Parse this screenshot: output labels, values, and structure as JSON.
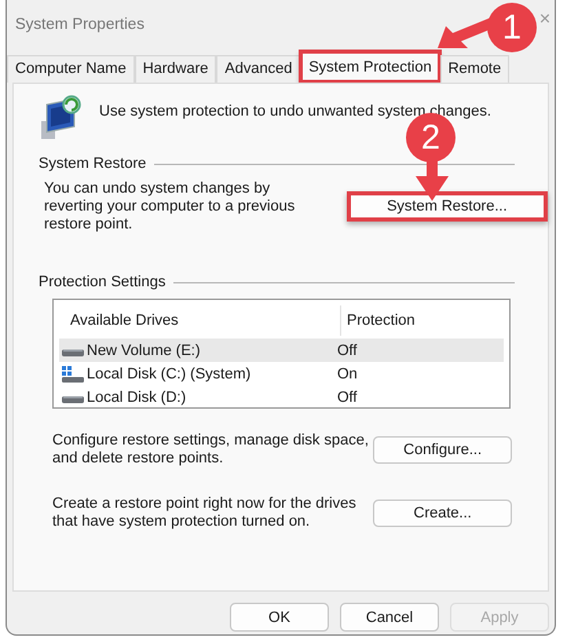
{
  "window": {
    "title": "System Properties",
    "close": "×"
  },
  "tabs": [
    {
      "label": "Computer Name",
      "selected": false,
      "highlighted": false
    },
    {
      "label": "Hardware",
      "selected": false,
      "highlighted": false
    },
    {
      "label": "Advanced",
      "selected": false,
      "highlighted": false
    },
    {
      "label": "System Protection",
      "selected": true,
      "highlighted": true
    },
    {
      "label": "Remote",
      "selected": false,
      "highlighted": false
    }
  ],
  "intro": "Use system protection to undo unwanted system changes.",
  "restore_group": {
    "title": "System Restore",
    "text": "You can undo system changes by reverting your computer to a previous restore point.",
    "button": {
      "label": "System Restore...",
      "highlighted": true
    }
  },
  "protection_group": {
    "title": "Protection Settings",
    "columns": [
      "Available Drives",
      "Protection"
    ],
    "rows": [
      {
        "kind": "drive",
        "drive": "New Volume (E:)",
        "protection": "Off",
        "selected": true
      },
      {
        "kind": "system",
        "drive": "Local Disk (C:) (System)",
        "protection": "On",
        "selected": false
      },
      {
        "kind": "drive",
        "drive": "Local Disk (D:)",
        "protection": "Off",
        "selected": false
      }
    ],
    "actions": [
      {
        "text": "Configure restore settings, manage disk space, and delete restore points.",
        "button": "Configure..."
      },
      {
        "text": "Create a restore point right now for the drives that have system protection turned on.",
        "button": "Create..."
      }
    ]
  },
  "buttons": [
    {
      "label": "OK",
      "disabled": false
    },
    {
      "label": "Cancel",
      "disabled": false
    },
    {
      "label": "Apply",
      "disabled": true
    }
  ],
  "annotations": [
    {
      "label": "1"
    },
    {
      "label": "2"
    }
  ]
}
